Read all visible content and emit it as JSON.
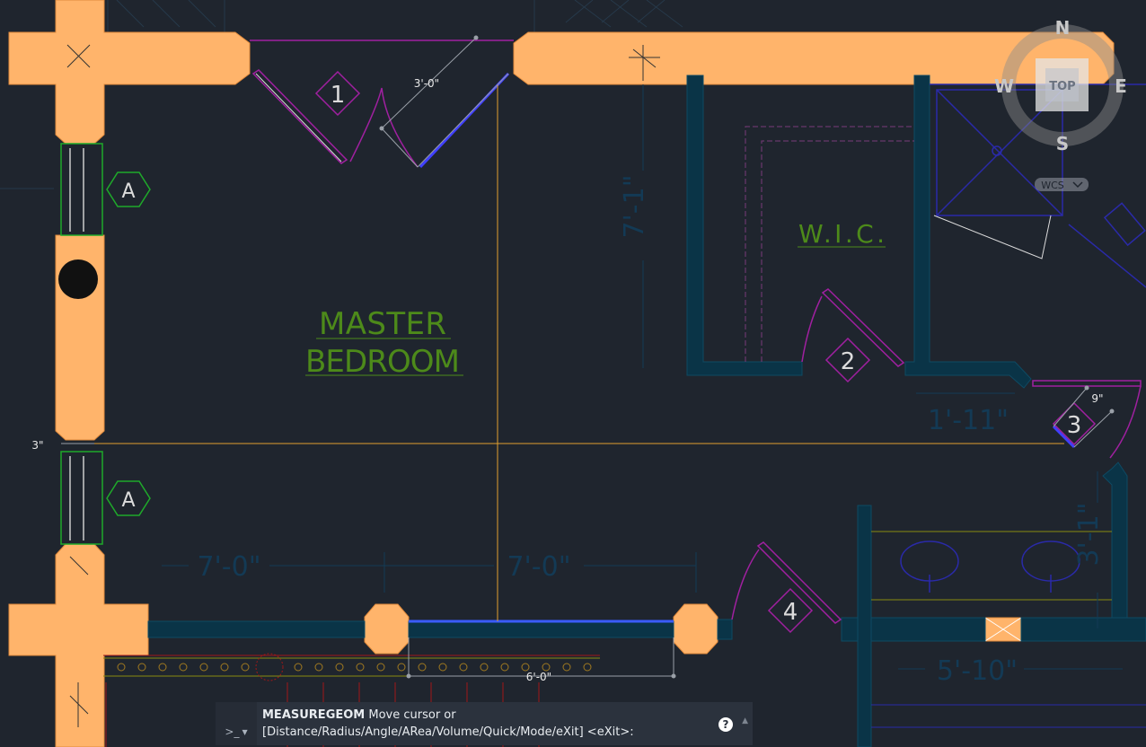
{
  "drawing": {
    "room_labels": {
      "master_line1": "MASTER",
      "master_line2": "BEDROOM",
      "wic": "W.I.C."
    },
    "door_tags": [
      "1",
      "2",
      "3",
      "4"
    ],
    "window_tags": [
      "A",
      "A"
    ],
    "measure_dimensions": {
      "door1": "3'-0\"",
      "door3": "9\"",
      "window": "6'-0\"",
      "wall_gap": "3\""
    },
    "faint_dimensions": {
      "left_7": "7'-0\"",
      "right_7": "7'-0\"",
      "wic_height": "7'-1\"",
      "closet_width": "1'-11\"",
      "bath_width": "5'-10\"",
      "bath_height": "3'-1\""
    },
    "colors": {
      "background": "#1f252e",
      "wall_fill": "#ffb46b",
      "interior_wall": "#0a3447",
      "measure_line": "#e0a030",
      "room_text": "#4d8a1a",
      "door_swing": "#a020a0"
    }
  },
  "viewcube": {
    "north": "N",
    "south": "S",
    "east": "E",
    "west": "W",
    "face": "TOP",
    "ucs_label": "WCS",
    "ucs_icon": "chevron-down-icon"
  },
  "command_line": {
    "prompt_icon": ">_",
    "command": "MEASUREGEOM",
    "message": "Move cursor or [Distance/Radius/Angle/ARea/Volume/Quick/Mode/eXit] <eXit>:",
    "help_icon": "?",
    "history_icon": "▲"
  }
}
